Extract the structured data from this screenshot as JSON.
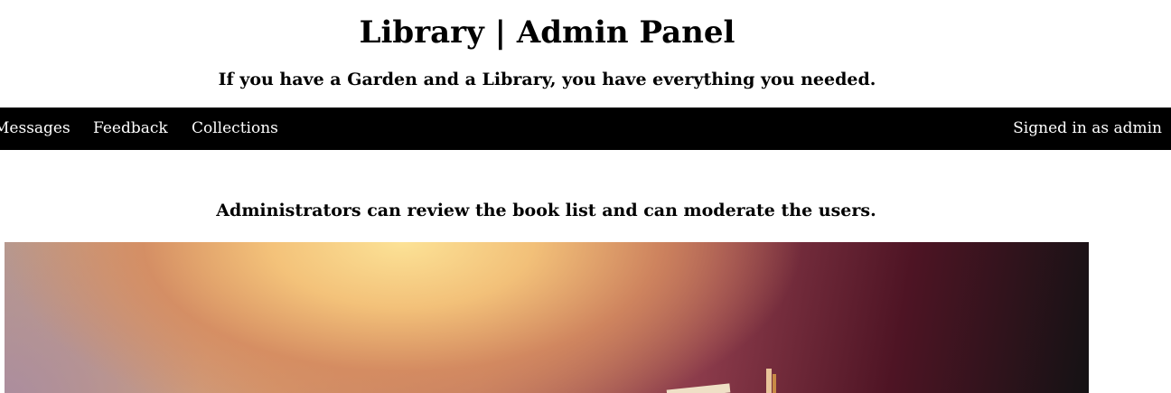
{
  "header": {
    "title": "Library | Admin Panel",
    "tagline": "If you have a Garden and a Library, you have everything you needed."
  },
  "navbar": {
    "items": [
      {
        "label": "Messages"
      },
      {
        "label": "Feedback"
      },
      {
        "label": "Collections"
      }
    ],
    "user_status": "Signed in as admin"
  },
  "main": {
    "statement": "Administrators can review the book list and can moderate the users.",
    "hero_image": "library-books-banner"
  },
  "colors": {
    "navbar_bg": "#000000",
    "navbar_text": "#ffffff",
    "page_bg": "#ffffff"
  }
}
